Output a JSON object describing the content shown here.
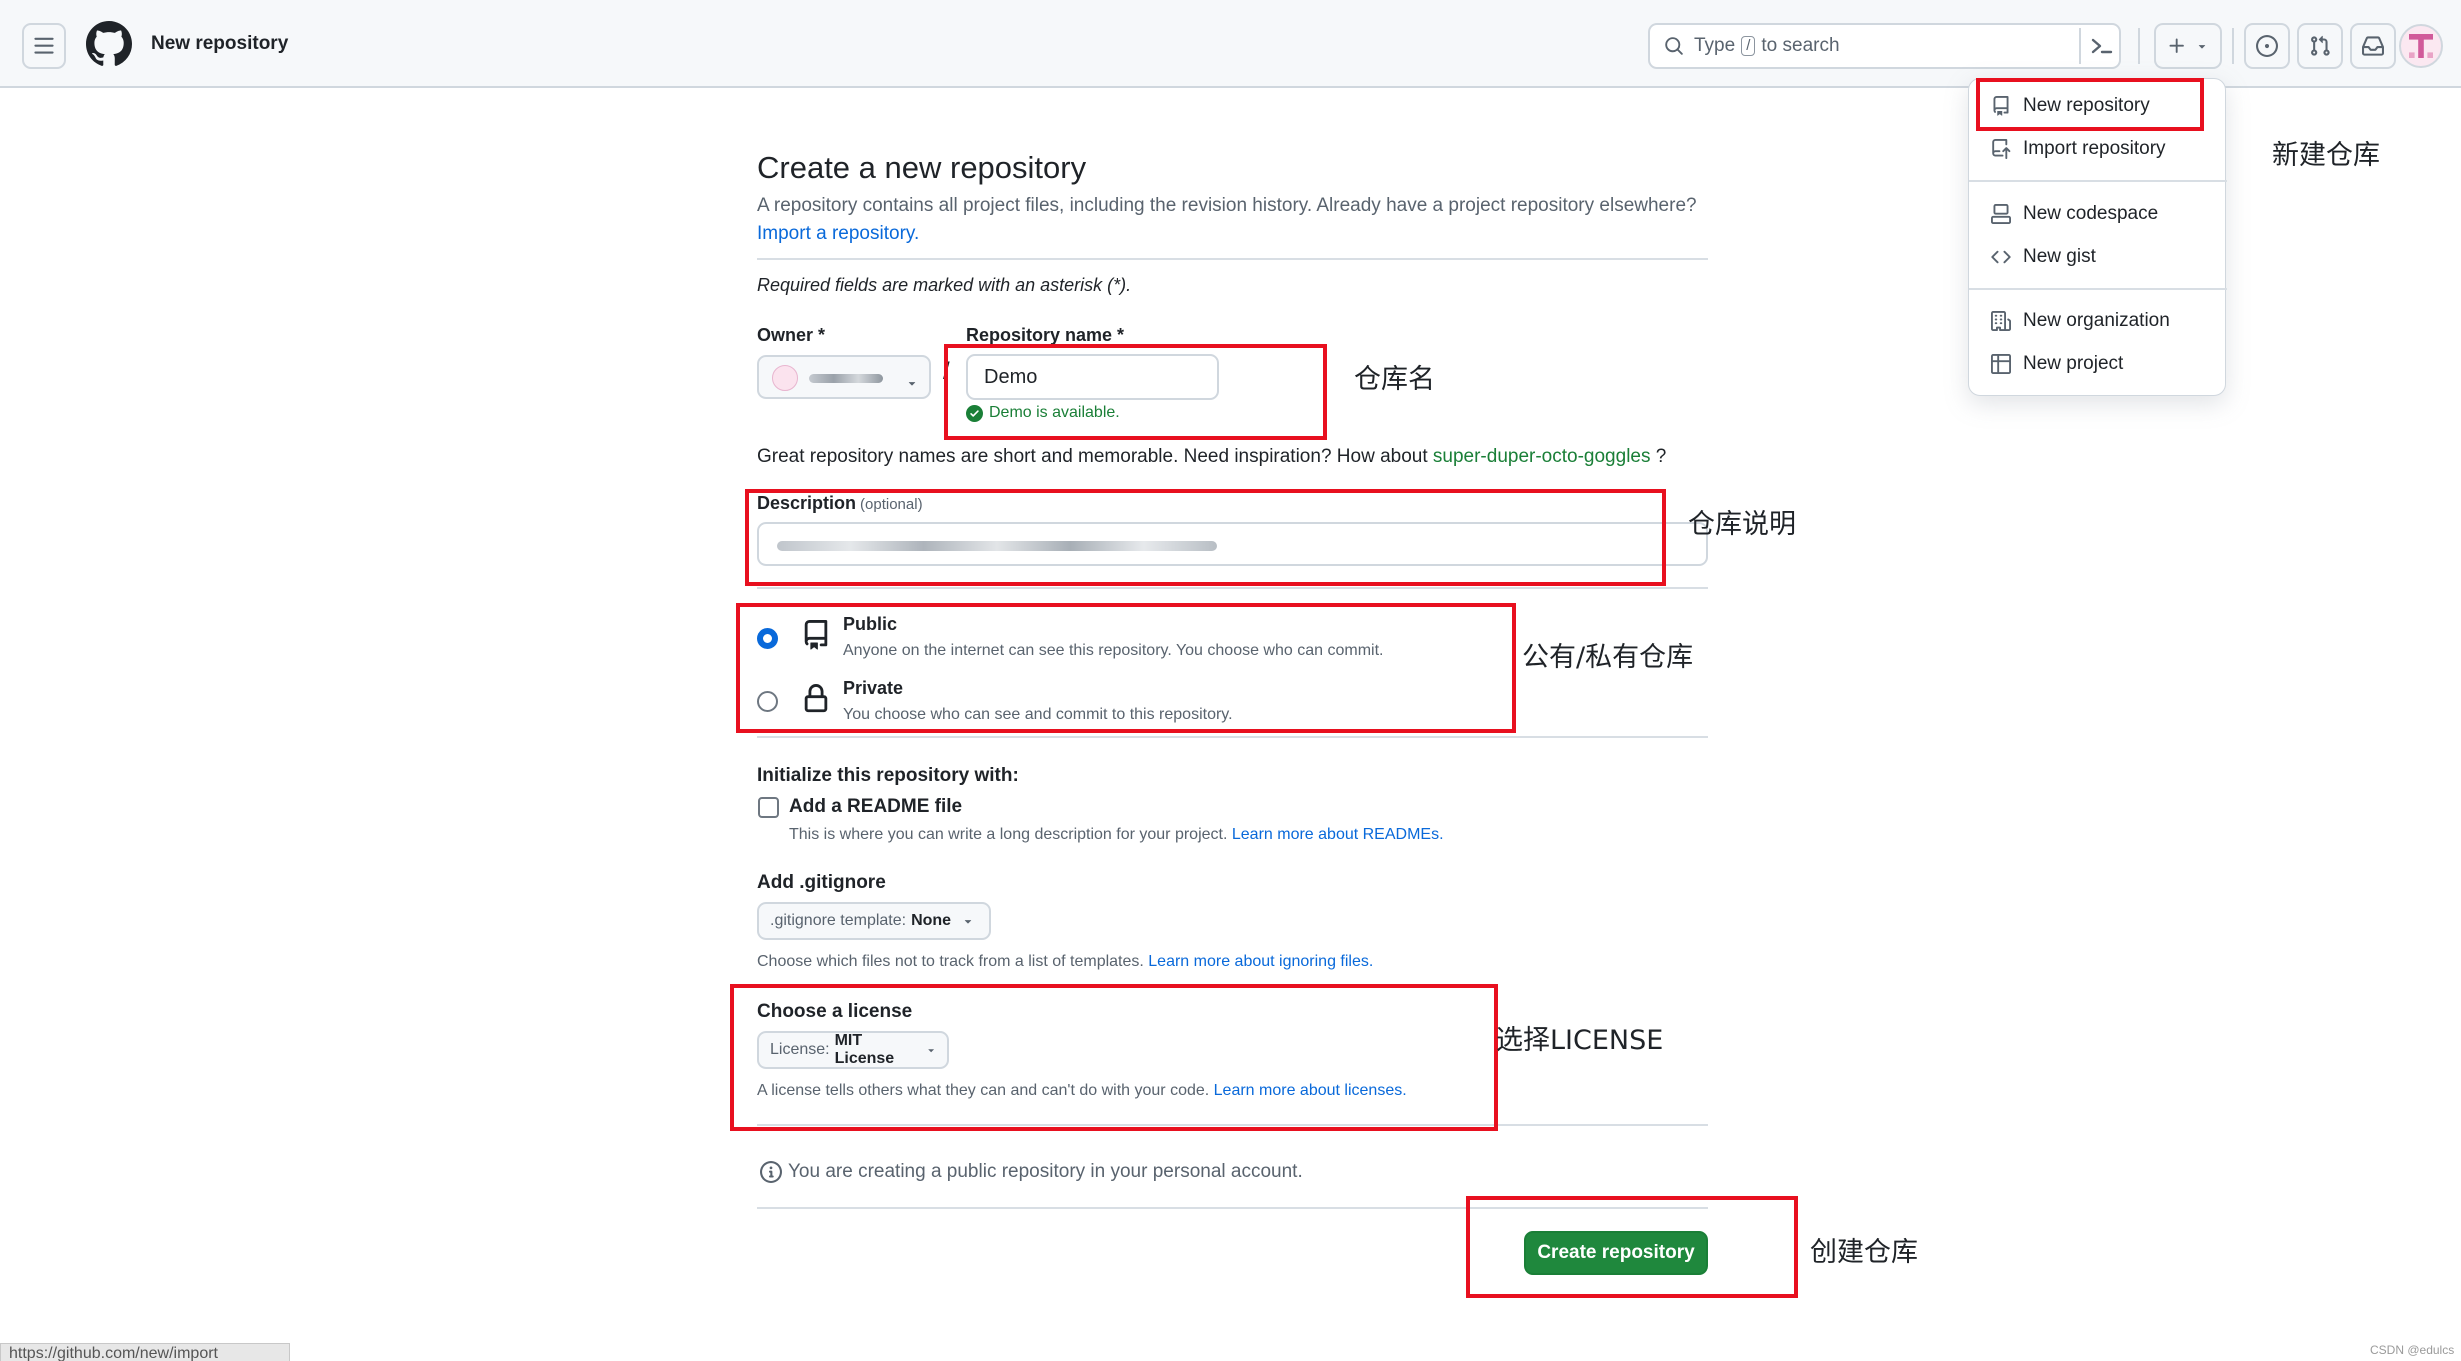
{
  "header": {
    "context_title": "New repository",
    "search_prefix": "Type",
    "search_key": "/",
    "search_suffix": "to search"
  },
  "menu": {
    "items": [
      {
        "label": "New repository",
        "icon": "repo-icon"
      },
      {
        "label": "Import repository",
        "icon": "repo-push-icon"
      },
      {
        "label": "New codespace",
        "icon": "codespaces-icon"
      },
      {
        "label": "New gist",
        "icon": "code-icon"
      },
      {
        "label": "New organization",
        "icon": "organization-icon"
      },
      {
        "label": "New project",
        "icon": "table-icon"
      }
    ]
  },
  "main": {
    "title": "Create a new repository",
    "subtitle": "A repository contains all project files, including the revision history. Already have a project repository elsewhere?",
    "import_link": "Import a repository.",
    "required_note": "Required fields are marked with an asterisk (*).",
    "owner_label": "Owner *",
    "name_label": "Repository name *",
    "separator": "/",
    "name_value": "Demo",
    "available_msg": "Demo is available.",
    "inspire_text": "Great repository names are short and memorable. Need inspiration? How about",
    "inspire_suggestion": "super-duper-octo-goggles",
    "inspire_end": "?",
    "description_label": "Description",
    "description_optional": "(optional)",
    "visibility": {
      "public_title": "Public",
      "public_desc": "Anyone on the internet can see this repository. You choose who can commit.",
      "private_title": "Private",
      "private_desc": "You choose who can see and commit to this repository.",
      "selected": "Public"
    },
    "init_label": "Initialize this repository with:",
    "readme_label": "Add a README file",
    "readme_desc": "This is where you can write a long description for your project.",
    "readme_link": "Learn more about READMEs.",
    "readme_checked": false,
    "gitignore_label": "Add .gitignore",
    "gitignore_dd_prefix": ".gitignore template:",
    "gitignore_dd_value": "None",
    "gitignore_help": "Choose which files not to track from a list of templates.",
    "gitignore_link": "Learn more about ignoring files.",
    "license_label": "Choose a license",
    "license_dd_prefix": "License:",
    "license_dd_value": "MIT License",
    "license_help": "A license tells others what they can and can't do with your code.",
    "license_link": "Learn more about licenses.",
    "public_note": "You are creating a public repository in your personal account.",
    "create_button": "Create repository"
  },
  "annotations": {
    "new_repo": "新建仓库",
    "repo_name": "仓库名",
    "repo_desc": "仓库说明",
    "visibility": "公有/私有仓库",
    "license": "选择LICENSE",
    "create": "创建仓库"
  },
  "status_url": "https://github.com/new/import",
  "watermark": "CSDN @edulcs",
  "colors": {
    "accent_blue": "#0969da",
    "success_green": "#1a7f37",
    "button_green": "#1f883d",
    "annotation_red": "#e8101f"
  }
}
